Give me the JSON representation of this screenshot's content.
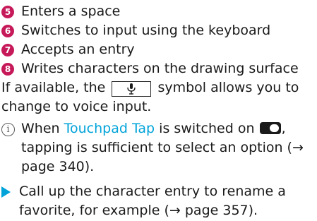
{
  "legend": [
    {
      "number": "5",
      "text": "Enters a space"
    },
    {
      "number": "6",
      "text": "Switches to input using the keyboard"
    },
    {
      "number": "7",
      "text": "Accepts an entry"
    },
    {
      "number": "8",
      "text": "Writes characters on the drawing surface"
    }
  ],
  "voice": {
    "before": "If available, the",
    "after": "symbol allows you to change to voice input.",
    "icon": "microphone-icon"
  },
  "note": {
    "icon": "info-icon",
    "icon_glyph": "i",
    "before": "When",
    "link": "Touchpad Tap",
    "middle": "is switched on",
    "after": ", tapping is sufficient to select an option (→ page 340)."
  },
  "step": {
    "icon": "triangle-bullet-icon",
    "text": "Call up the character entry to rename a favorite, for example (→ page 357)."
  },
  "colors": {
    "number_badge": "#c6195a",
    "link": "#00a3d9",
    "bullet": "#00a3d9",
    "text": "#1a1a1a"
  }
}
